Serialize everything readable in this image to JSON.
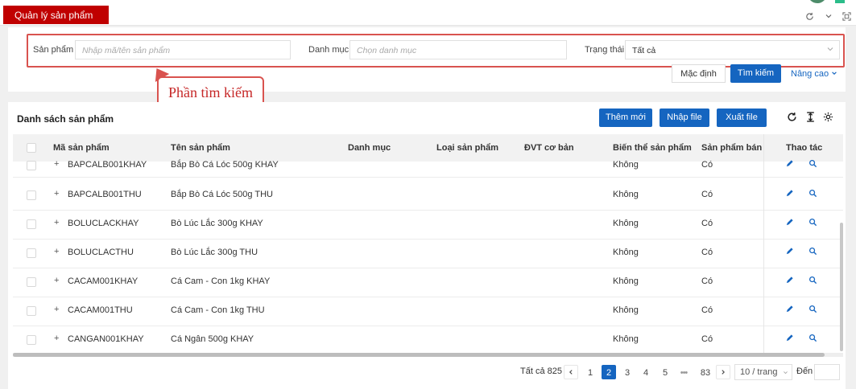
{
  "header": {
    "tab_title": "Quản lý sản phẩm",
    "icons": [
      "refresh-icon",
      "chevron-down-icon",
      "expand-icon"
    ]
  },
  "search": {
    "product_label": "Sản phẩm",
    "product_placeholder": "Nhập mã/tên sản phẩm",
    "category_label": "Danh mục",
    "category_placeholder": "Chọn danh mục",
    "status_label": "Trạng thái",
    "status_value": "Tất cả",
    "default_button": "Mặc định",
    "search_button": "Tìm kiếm",
    "advanced_link": "Nâng cao"
  },
  "callout": {
    "text": "Phần tìm kiếm"
  },
  "list": {
    "title": "Danh sách sản phẩm",
    "add_button": "Thêm mới",
    "import_button": "Nhập file",
    "export_button": "Xuất file",
    "columns": [
      "Mã sản phẩm",
      "Tên sản phẩm",
      "Danh mục",
      "Loại sản phẩm",
      "ĐVT cơ bản",
      "Biến thể sản phẩm",
      "Sản phẩm bán",
      "Thao tác"
    ],
    "rows": [
      {
        "code": "BAPCALB001KHAY",
        "name": "Bắp Bò Cá Lóc 500g KHAY",
        "variant": "Không",
        "sellable": "Có"
      },
      {
        "code": "BAPCALB001THU",
        "name": "Bắp Bò Cá Lóc 500g THU",
        "variant": "Không",
        "sellable": "Có"
      },
      {
        "code": "BOLUCLACKHAY",
        "name": "Bò Lúc Lắc 300g KHAY",
        "variant": "Không",
        "sellable": "Có"
      },
      {
        "code": "BOLUCLACTHU",
        "name": "Bò Lúc Lắc 300g THU",
        "variant": "Không",
        "sellable": "Có"
      },
      {
        "code": "CACAM001KHAY",
        "name": "Cá Cam - Con 1kg KHAY",
        "variant": "Không",
        "sellable": "Có"
      },
      {
        "code": "CACAM001THU",
        "name": "Cá Cam - Con 1kg THU",
        "variant": "Không",
        "sellable": "Có"
      },
      {
        "code": "CANGAN001KHAY",
        "name": "Cá Ngân 500g KHAY",
        "variant": "Không",
        "sellable": "Có"
      }
    ]
  },
  "pagination": {
    "total": "Tất cả 825",
    "pages": [
      "1",
      "2",
      "3",
      "4",
      "5"
    ],
    "current_page": "2",
    "ellipsis": "•••",
    "last_page": "83",
    "page_size": "10 / trang",
    "goto_label": "Đến"
  },
  "colors": {
    "brand_red": "#c00000",
    "primary_blue": "#1565c0",
    "callout_red": "#d9534f"
  }
}
